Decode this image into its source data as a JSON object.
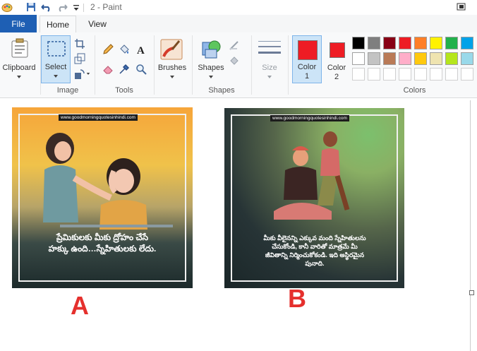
{
  "window": {
    "title": "2 - Paint"
  },
  "tabs": {
    "file": "File",
    "home": "Home",
    "view": "View"
  },
  "ribbon": {
    "clipboard": {
      "label": "Clipboard"
    },
    "image": {
      "select_label": "Select",
      "group_label": "Image"
    },
    "tools": {
      "group_label": "Tools"
    },
    "brushes": {
      "label": "Brushes"
    },
    "shapes": {
      "label": "Shapes",
      "group_label": "Shapes"
    },
    "size": {
      "label": "Size"
    },
    "color1": {
      "label_line1": "Color",
      "label_line2": "1",
      "color": "#ee1c24"
    },
    "color2": {
      "label_line1": "Color",
      "label_line2": "2",
      "color": "#ee1c24"
    },
    "colors": {
      "group_label": "Colors",
      "row1": [
        "#000000",
        "#7f7f7f",
        "#880015",
        "#ed1c24",
        "#ff7f27",
        "#fff200",
        "#22b14c",
        "#00a2e8"
      ],
      "row2": [
        "#ffffff",
        "#c3c3c3",
        "#b97a57",
        "#ffaec9",
        "#ffc90e",
        "#efe4b0",
        "#b5e61d",
        "#99d9ea"
      ]
    }
  },
  "canvas": {
    "card_a": {
      "site": "www.goodmorningquotesinhindi.com",
      "quote_line1": "ప్రేమికులకు మీకు ద్రోహం చేసే",
      "quote_line2": "హక్కు ఉంది…స్నేహితులకు లేదు."
    },
    "card_b": {
      "site": "www.goodmorningquotesinhindi.com",
      "quote_line1": "మీకు వీలైనన్ని ఎక్కువ మంది స్నేహితులను",
      "quote_line2": "చేసుకోండి, కానీ వారితో మాత్రమే మీ",
      "quote_line3": "జీవితాన్ని నిర్మించుకోకండి. ఇది అస్థిరమైన",
      "quote_line4": "పునాది."
    },
    "label_a": "A",
    "label_b": "B"
  }
}
